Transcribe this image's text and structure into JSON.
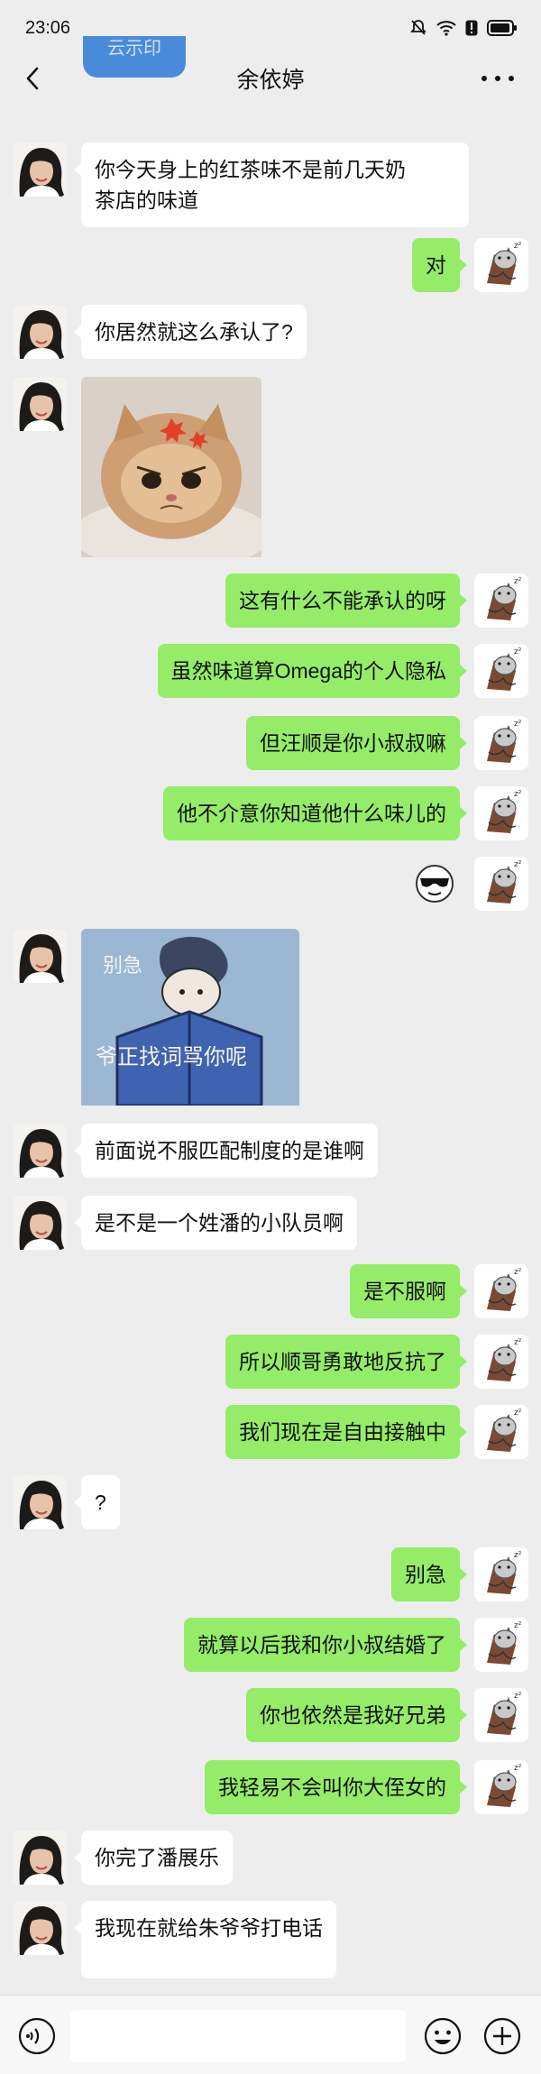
{
  "status_bar": {
    "time": "23:06"
  },
  "header": {
    "title": "余依婷",
    "notification_tab_text": "云示印"
  },
  "messages": [
    {
      "side": "left",
      "type": "text",
      "lines": [
        "你今天身上的红茶味不是前几天奶",
        "茶店的味道"
      ]
    },
    {
      "side": "right",
      "type": "text",
      "text": "对"
    },
    {
      "side": "left",
      "type": "text",
      "text": "你居然就这么承认了?"
    },
    {
      "side": "left",
      "type": "image",
      "description": "angry-kitten-sticker"
    },
    {
      "side": "right",
      "type": "text",
      "text": "这有什么不能承认的呀"
    },
    {
      "side": "right",
      "type": "text",
      "text": "虽然味道算Omega的个人隐私"
    },
    {
      "side": "right",
      "type": "text",
      "text": "但汪顺是你小叔叔嘛"
    },
    {
      "side": "right",
      "type": "text",
      "text": "他不介意你知道他什么味儿的"
    },
    {
      "side": "right",
      "type": "emoji",
      "description": "cool-face-emoji"
    },
    {
      "side": "left",
      "type": "image",
      "description": "reading-book-sticker",
      "caption_top": "别急",
      "caption_bottom": "爷正找词骂你呢"
    },
    {
      "side": "left",
      "type": "text",
      "text": "前面说不服匹配制度的是谁啊"
    },
    {
      "side": "left",
      "type": "text",
      "text": "是不是一个姓潘的小队员啊"
    },
    {
      "side": "right",
      "type": "text",
      "text": "是不服啊"
    },
    {
      "side": "right",
      "type": "text",
      "text": "所以顺哥勇敢地反抗了"
    },
    {
      "side": "right",
      "type": "text",
      "text": "我们现在是自由接触中"
    },
    {
      "side": "left",
      "type": "text",
      "text": "?"
    },
    {
      "side": "right",
      "type": "text",
      "text": "别急"
    },
    {
      "side": "right",
      "type": "text",
      "text": "就算以后我和你小叔结婚了"
    },
    {
      "side": "right",
      "type": "text",
      "text": "你也依然是我好兄弟"
    },
    {
      "side": "right",
      "type": "text",
      "text": "我轻易不会叫你大侄女的"
    },
    {
      "side": "left",
      "type": "text",
      "text": "你完了潘展乐"
    },
    {
      "side": "left",
      "type": "text",
      "text": "我现在就给朱爷爷打电话"
    }
  ],
  "colors": {
    "background": "#ededed",
    "bubble_self": "#95ec69",
    "bubble_other": "#ffffff"
  },
  "icons": [
    "back-arrow-icon",
    "more-icon",
    "voice-icon",
    "emoji-icon",
    "plus-icon"
  ]
}
